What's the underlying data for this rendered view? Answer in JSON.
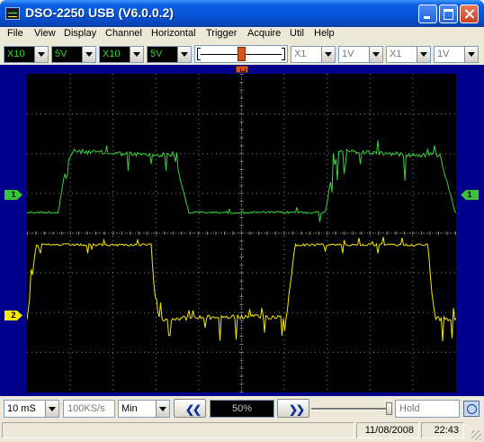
{
  "window": {
    "title": "DSO-2250 USB (V6.0.0.2)"
  },
  "menu": [
    "File",
    "View",
    "Display",
    "Channel",
    "Horizontal",
    "Trigger",
    "Acquire",
    "Util",
    "Help"
  ],
  "toolbar": {
    "ch1_probe": "X10",
    "ch1_volts": "5V",
    "ch2_probe": "X10",
    "ch2_volts": "5V",
    "ch3_probe": "X1",
    "ch3_volts": "1V",
    "ch4_probe": "X1",
    "ch4_volts": "1V"
  },
  "markers": {
    "ch1": "1",
    "ch2": "2"
  },
  "bottom": {
    "timebase": "10 mS",
    "sample_rate": "100KS/s",
    "mode": "Min",
    "prev": "❮❮",
    "position": "50%",
    "next": "❯❯",
    "run_state": "Hold"
  },
  "status": {
    "date": "11/08/2008",
    "time": "22:43"
  },
  "colors": {
    "ch1": "#37d33a",
    "ch2": "#f5e900",
    "background": "#000000",
    "frame": "#00008b",
    "grid": "#808080"
  }
}
